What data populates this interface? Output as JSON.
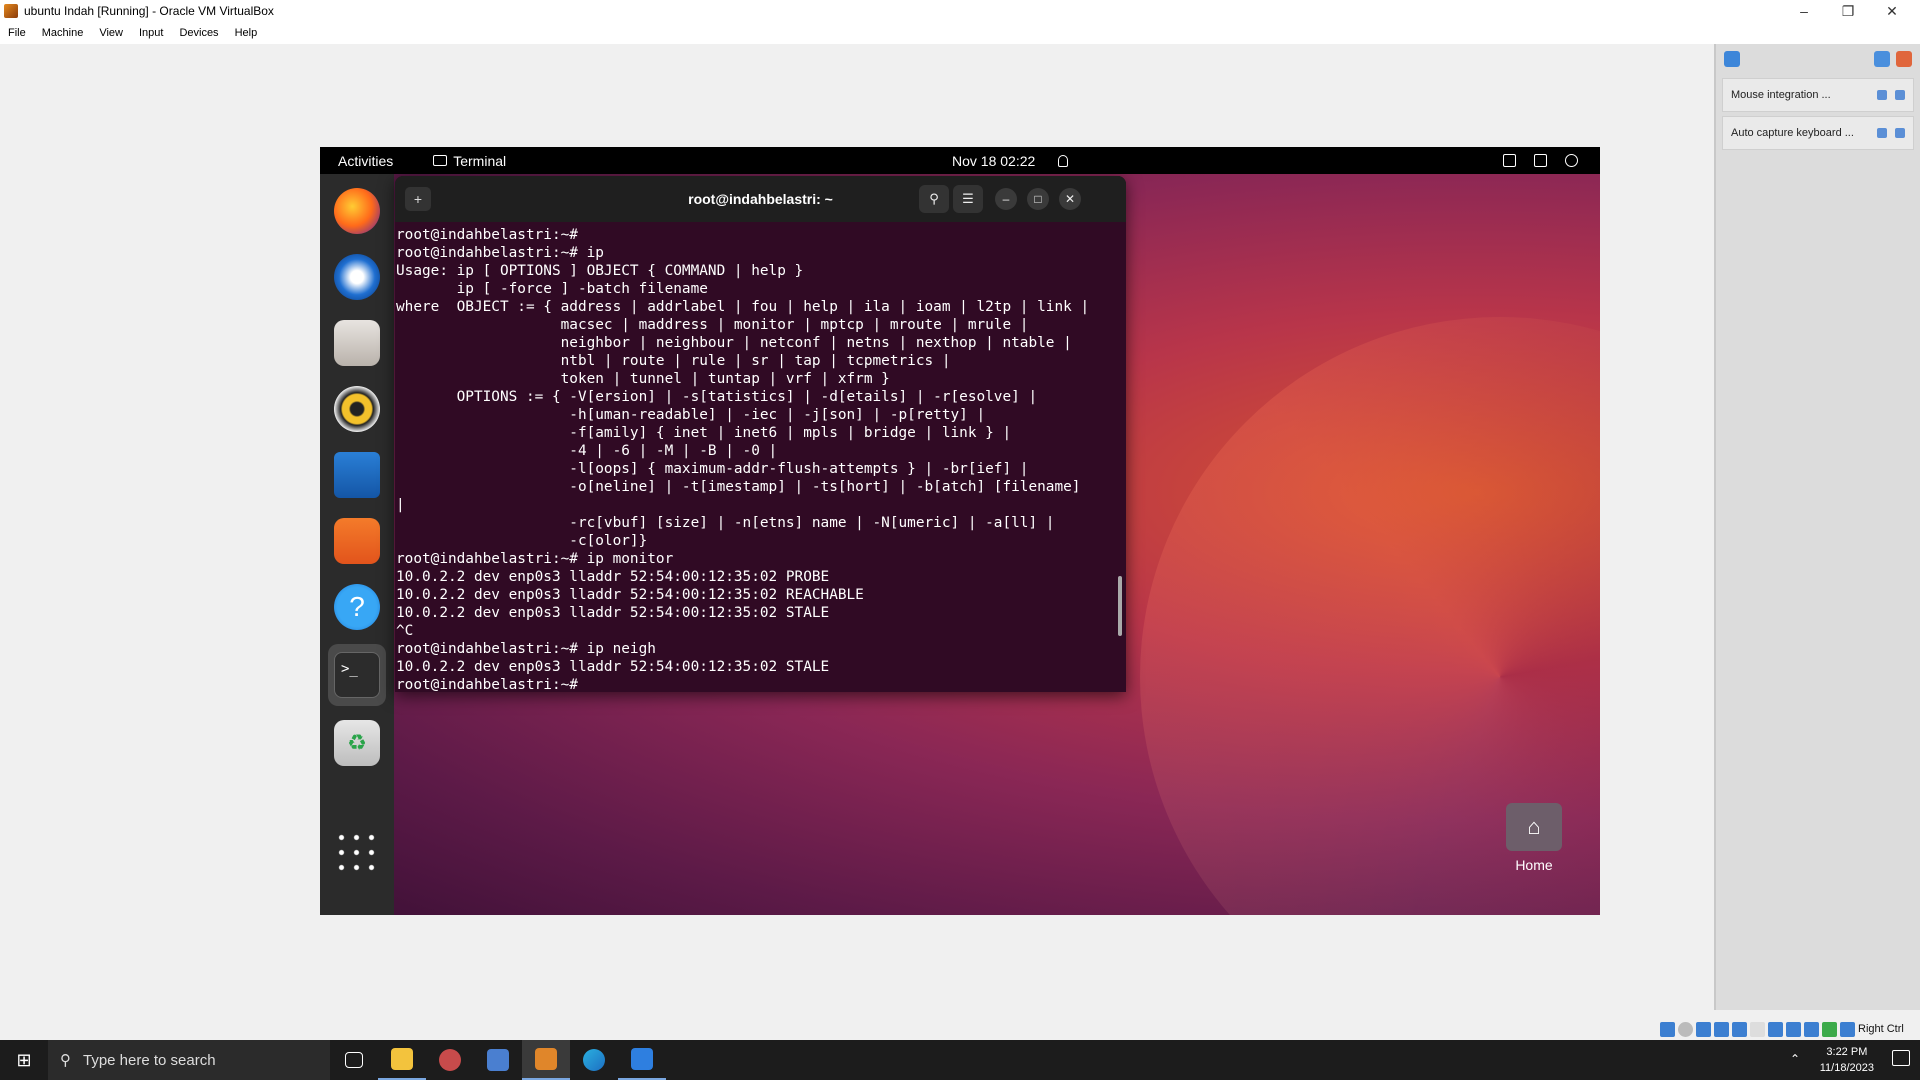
{
  "window": {
    "title": "ubuntu Indah [Running] - Oracle VM VirtualBox",
    "menu": [
      "File",
      "Machine",
      "View",
      "Input",
      "Devices",
      "Help"
    ]
  },
  "side_panel": {
    "notifications": [
      "Mouse integration ...",
      "Auto capture keyboard ..."
    ]
  },
  "status_bar": {
    "host_key": "Right Ctrl"
  },
  "guest": {
    "topbar": {
      "activities": "Activities",
      "app": "Terminal",
      "clock": "Nov 18  02:22"
    },
    "dock": {
      "items": [
        "firefox",
        "thunderbird",
        "files",
        "rhythmbox",
        "libreoffice-writer",
        "app-center",
        "help",
        "terminal",
        "trash",
        "show-apps"
      ]
    },
    "terminal": {
      "title": "root@indahbelastri: ~",
      "content": "root@indahbelastri:~#\nroot@indahbelastri:~# ip\nUsage: ip [ OPTIONS ] OBJECT { COMMAND | help }\n       ip [ -force ] -batch filename\nwhere  OBJECT := { address | addrlabel | fou | help | ila | ioam | l2tp | link |\n                   macsec | maddress | monitor | mptcp | mroute | mrule |\n                   neighbor | neighbour | netconf | netns | nexthop | ntable |\n                   ntbl | route | rule | sr | tap | tcpmetrics |\n                   token | tunnel | tuntap | vrf | xfrm }\n       OPTIONS := { -V[ersion] | -s[tatistics] | -d[etails] | -r[esolve] |\n                    -h[uman-readable] | -iec | -j[son] | -p[retty] |\n                    -f[amily] { inet | inet6 | mpls | bridge | link } |\n                    -4 | -6 | -M | -B | -0 |\n                    -l[oops] { maximum-addr-flush-attempts } | -br[ief] |\n                    -o[neline] | -t[imestamp] | -ts[hort] | -b[atch] [filename]\n|\n                    -rc[vbuf] [size] | -n[etns] name | -N[umeric] | -a[ll] |\n                    -c[olor]}\nroot@indahbelastri:~# ip monitor\n10.0.2.2 dev enp0s3 lladdr 52:54:00:12:35:02 PROBE\n10.0.2.2 dev enp0s3 lladdr 52:54:00:12:35:02 REACHABLE\n10.0.2.2 dev enp0s3 lladdr 52:54:00:12:35:02 STALE\n^C\nroot@indahbelastri:~# ip neigh\n10.0.2.2 dev enp0s3 lladdr 52:54:00:12:35:02 STALE\nroot@indahbelastri:~#"
    },
    "desktop": {
      "home_label": "Home"
    }
  },
  "taskbar": {
    "search_placeholder": "Type here to search",
    "time": "3:22 PM",
    "date": "11/18/2023"
  }
}
